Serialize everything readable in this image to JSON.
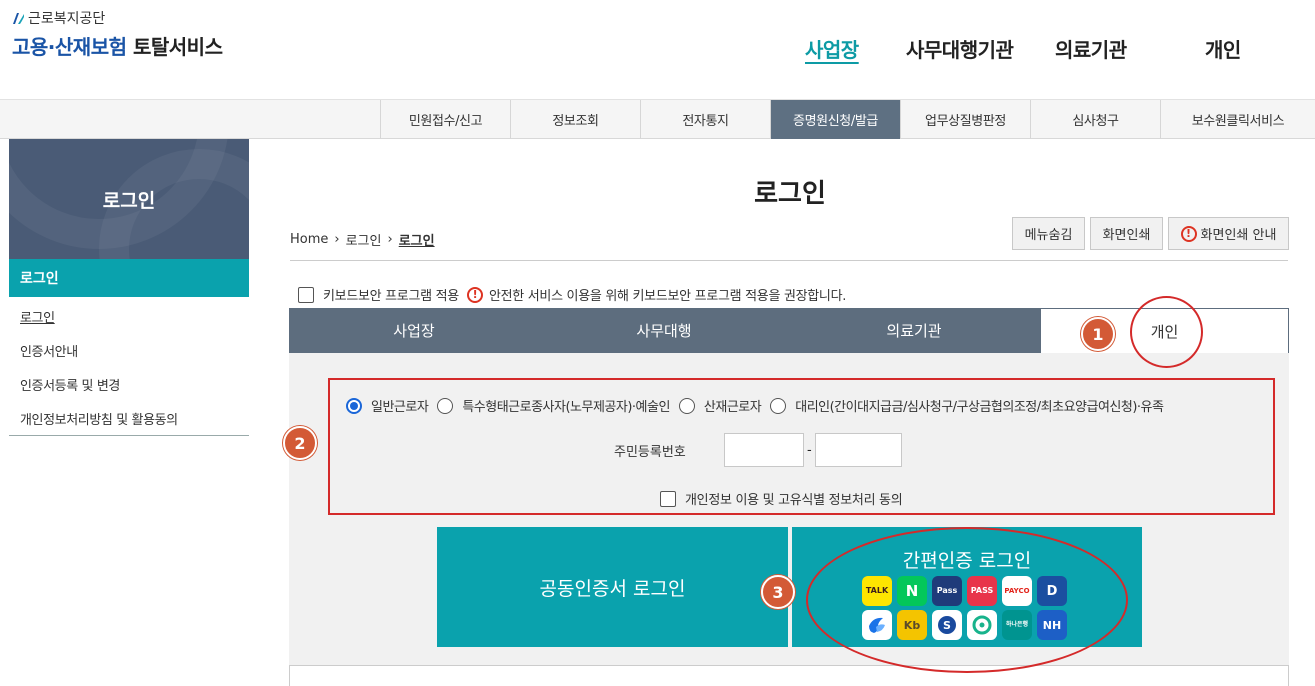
{
  "header": {
    "org_name": "근로복지공단",
    "service_title_blue": "고용·산재보험",
    "service_title_dark": "토탈서비스",
    "nav": [
      {
        "label": "사업장",
        "active": true
      },
      {
        "label": "사무대행기관",
        "active": false
      },
      {
        "label": "의료기관",
        "active": false
      },
      {
        "label": "개인",
        "active": false
      }
    ]
  },
  "menubar": {
    "items": [
      {
        "label": "민원접수/신고",
        "active": false
      },
      {
        "label": "정보조회",
        "active": false
      },
      {
        "label": "전자통지",
        "active": false
      },
      {
        "label": "증명원신청/발급",
        "active": true
      },
      {
        "label": "업무상질병판정",
        "active": false
      },
      {
        "label": "심사청구",
        "active": false
      },
      {
        "label": "보수원클릭서비스",
        "active": false
      }
    ]
  },
  "sidebar": {
    "hero_title": "로그인",
    "section_title": "로그인",
    "items": [
      {
        "label": "로그인",
        "current": true
      },
      {
        "label": "인증서안내",
        "current": false
      },
      {
        "label": "인증서등록 및 변경",
        "current": false
      },
      {
        "label": "개인정보처리방침 및 활용동의",
        "current": false
      }
    ]
  },
  "content": {
    "page_title": "로그인",
    "breadcrumb": [
      "Home",
      "로그인",
      "로그인"
    ],
    "buttons": {
      "hide_menu": "메뉴숨김",
      "print": "화면인쇄",
      "print_guide": "화면인쇄 안내"
    },
    "keyboard_security_label": "키보드보안 프로그램 적용",
    "keyboard_security_notice": "안전한 서비스 이용을 위해 키보드보안 프로그램 적용을 권장합니다.",
    "keyboard_security_checked": false,
    "tabs": [
      {
        "label": "사업장",
        "active": false
      },
      {
        "label": "사무대행",
        "active": false
      },
      {
        "label": "의료기관",
        "active": false
      },
      {
        "label": "개인",
        "active": true
      }
    ],
    "user_types": [
      {
        "label": "일반근로자",
        "checked": true
      },
      {
        "label": "특수형태근로종사자(노무제공자)·예술인",
        "checked": false
      },
      {
        "label": "산재근로자",
        "checked": false
      },
      {
        "label": "대리인(간이대지급금/심사청구/구상금협의조정/최초요양급여신청)·유족",
        "checked": false
      }
    ],
    "rrn_label": "주민등록번호",
    "rrn_separator": "-",
    "rrn_front": "",
    "rrn_back": "",
    "consent_label": "개인정보 이용 및 고유식별 정보처리 동의",
    "consent_checked": false,
    "cert_login_label": "공동인증서 로그인",
    "simple_login_label": "간편인증 로그인",
    "auth_providers": [
      {
        "name": "kakao",
        "text": "TALK",
        "bg": "#fee500",
        "fg": "#3c1e1e"
      },
      {
        "name": "naver",
        "text": "N",
        "bg": "#03c75a",
        "fg": "#ffffff"
      },
      {
        "name": "pass-kt",
        "text": "Pass",
        "bg": "#1f3b7a",
        "fg": "#ffffff"
      },
      {
        "name": "pass",
        "text": "PASS",
        "bg": "#e8344a",
        "fg": "#ffffff"
      },
      {
        "name": "payco",
        "text": "PAYCO",
        "bg": "#ffffff",
        "fg": "#e2231a"
      },
      {
        "name": "d-sign",
        "text": "D",
        "bg": "#1b4fa0",
        "fg": "#ffffff"
      },
      {
        "name": "toss",
        "text": "",
        "bg": "#ffffff",
        "fg": "#1a73e8"
      },
      {
        "name": "kb",
        "text": "Kb",
        "bg": "#f4c400",
        "fg": "#5a4a2a"
      },
      {
        "name": "shinhan",
        "text": "S",
        "bg": "#ffffff",
        "fg": "#1a4a9e"
      },
      {
        "name": "green-auth",
        "text": "",
        "bg": "#ffffff",
        "fg": "#18b38c"
      },
      {
        "name": "hana",
        "text": "하나은행",
        "bg": "#009490",
        "fg": "#ffffff"
      },
      {
        "name": "nh",
        "text": "NH",
        "bg": "#1d5fc6",
        "fg": "#ffffff"
      }
    ]
  },
  "annotations": [
    "1",
    "2",
    "3"
  ],
  "colors": {
    "accent_teal": "#0aa2ad",
    "tab_bar": "#5d6d7e",
    "highlight_red": "#d42a2a",
    "marker_orange": "#d35a36"
  }
}
